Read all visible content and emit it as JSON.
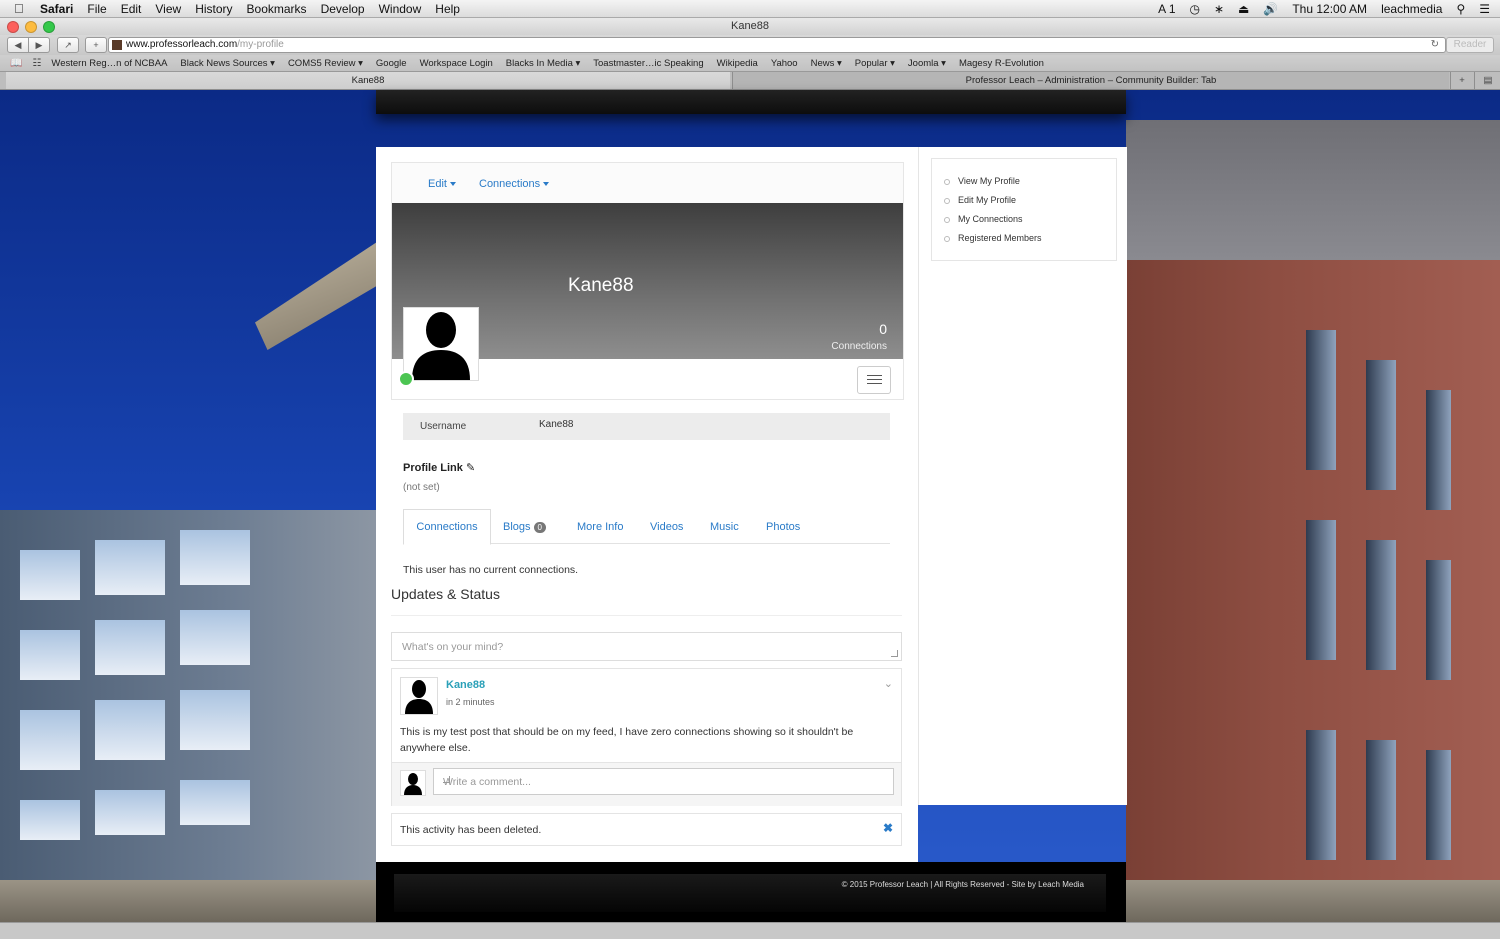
{
  "os_menu": {
    "items": [
      "Safari",
      "File",
      "Edit",
      "View",
      "History",
      "Bookmarks",
      "Develop",
      "Window",
      "Help"
    ],
    "status_items": [
      "1",
      "Thu 12:00 AM",
      "leachmedia"
    ]
  },
  "window": {
    "title": "Kane88",
    "url_host": "www.professorleach.com",
    "url_path": "/my-profile",
    "reader_label": "Reader"
  },
  "bookmarks": [
    "Western Reg…n of NCBAA",
    "Black News Sources ▾",
    "COMS5 Review ▾",
    "Google",
    "Workspace Login",
    "Blacks In Media ▾",
    "Toastmaster…ic Speaking",
    "Wikipedia",
    "Yahoo",
    "News ▾",
    "Popular ▾",
    "Joomla ▾",
    "Magesy R-Evolution"
  ],
  "tabs": [
    {
      "label": "Kane88"
    },
    {
      "label": "Professor Leach – Administration – Community Builder: Tab"
    }
  ],
  "profile": {
    "nav_edit": "Edit",
    "nav_connections": "Connections",
    "username_display": "Kane88",
    "connections_count": "0",
    "connections_label": "Connections",
    "field_username_label": "Username",
    "field_username_value": "Kane88",
    "profile_link_label": "Profile Link",
    "profile_link_value": "(not set)",
    "tabs": [
      "Connections",
      "Blogs",
      "More Info",
      "Videos",
      "Music",
      "Photos"
    ],
    "blogs_count": "0",
    "no_connections_text": "This user has no current connections."
  },
  "activity": {
    "heading": "Updates & Status",
    "status_placeholder": "What's on your mind?",
    "post_author": "Kane88",
    "post_time": "in 2 minutes",
    "post_text": "This is my test post that should be on my feed, I have zero connections showing so it shouldn't be anywhere else.",
    "comment_placeholder": "Write a comment...",
    "deleted_text": "This activity has been deleted."
  },
  "sidebar": {
    "items": [
      "View My Profile",
      "Edit My Profile",
      "My Connections",
      "Registered Members"
    ]
  },
  "footer": {
    "copyright": "© 2015 Professor Leach | All Rights Reserved - Site by Leach Media"
  },
  "colors": {
    "link": "#2a7bc8",
    "author": "#2aa0b8",
    "online": "#4cc552"
  }
}
